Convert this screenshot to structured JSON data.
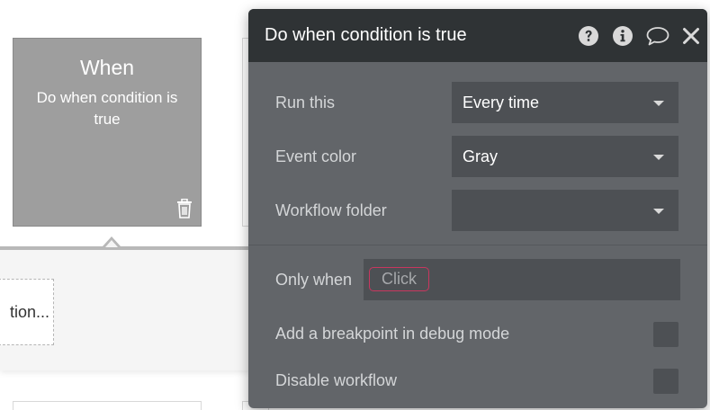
{
  "event_card": {
    "title": "When",
    "subtitle": "Do when condition is true",
    "trash_icon": "trash-icon"
  },
  "condition_box": {
    "text": "tion..."
  },
  "panel": {
    "title": "Do when condition is true",
    "icons": [
      "help-icon",
      "info-icon",
      "comment-icon",
      "close-icon"
    ],
    "run_this": {
      "label": "Run this",
      "value": "Every time"
    },
    "event_color": {
      "label": "Event color",
      "value": "Gray"
    },
    "workflow_folder": {
      "label": "Workflow folder",
      "value": ""
    },
    "only_when": {
      "label": "Only when",
      "chip": "Click"
    },
    "breakpoint": {
      "label": "Add a breakpoint in debug mode",
      "checked": false
    },
    "disable": {
      "label": "Disable workflow",
      "checked": false
    }
  },
  "colors": {
    "panel_bg": "#626569",
    "header_bg": "#2f3335",
    "field_bg": "#4d5054",
    "chip_border": "#c8375f",
    "event_card_gray": "#9e9e9e"
  }
}
